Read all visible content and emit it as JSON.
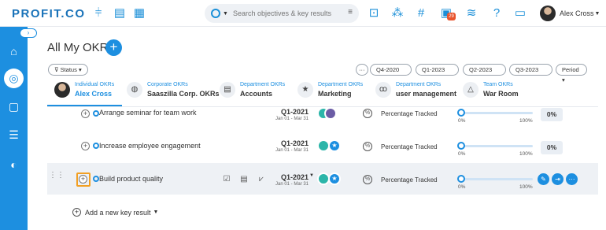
{
  "app": {
    "logo": "PROFIT.CO",
    "accent": "#1d8fe0"
  },
  "topbar": {
    "search_placeholder": "Search objectives & key results",
    "user_name": "Alex Cross",
    "notification_count": "29"
  },
  "page": {
    "title": "All My OKRs"
  },
  "filters": {
    "status": "Status",
    "periods": [
      "Q4-2020",
      "Q1-2023",
      "Q2-2023",
      "Q3-2023"
    ],
    "period_select": "Period",
    "more": "···"
  },
  "tabs": [
    {
      "category": "Individual OKRs",
      "name": "Alex Cross",
      "icon": "avatar"
    },
    {
      "category": "Corporate OKRs",
      "name": "Saaszilla Corp. OKRs",
      "icon": "globe-icon"
    },
    {
      "category": "Department OKRs",
      "name": "Accounts",
      "icon": "document-icon"
    },
    {
      "category": "Department OKRs",
      "name": "Marketing",
      "icon": "star-icon"
    },
    {
      "category": "Department OKRs",
      "name": "user management",
      "icon": "users-icon"
    },
    {
      "category": "Team OKRs",
      "name": "War Room",
      "icon": "triangle-icon"
    }
  ],
  "key_results": [
    {
      "title": "Arrange seminar for team work",
      "quarter": "Q1-2021",
      "dates": "Jan 01 - Mar 31",
      "tracking": "Percentage Tracked",
      "min": "0%",
      "max": "100%",
      "progress": "0%",
      "progress_value": 0
    },
    {
      "title": "Increase employee engagement",
      "quarter": "Q1-2021",
      "dates": "Jan 01 - Mar 31",
      "tracking": "Percentage Tracked",
      "min": "0%",
      "max": "100%",
      "progress": "0%",
      "progress_value": 0
    },
    {
      "title": "Build product quality",
      "quarter": "Q1-2021",
      "dates": "Jan 01 - Mar 31",
      "tracking": "Percentage Tracked",
      "min": "0%",
      "max": "100%",
      "progress": "",
      "progress_value": 0
    }
  ],
  "add_key_result": "Add a new key result"
}
